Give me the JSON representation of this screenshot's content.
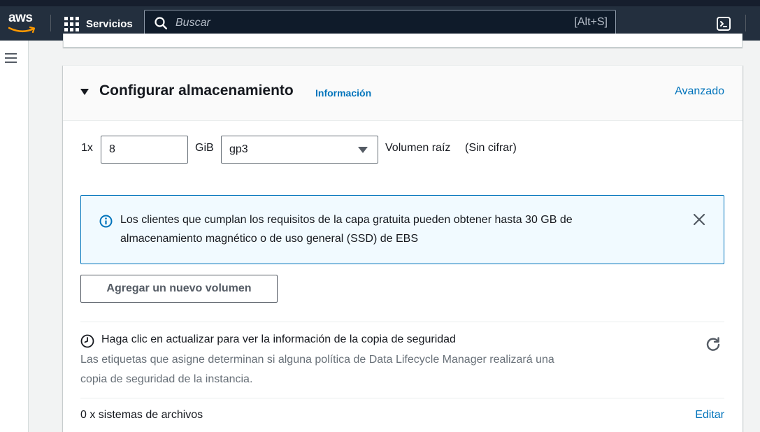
{
  "topbar": {
    "logo_text": "aws",
    "services_label": "Servicios",
    "search_placeholder": "Buscar",
    "search_shortcut": "[Alt+S]",
    "cloudshell_icon": "cloudshell-icon"
  },
  "storage": {
    "title": "Configurar almacenamiento",
    "info_link": "Información",
    "advanced_link": "Avanzado",
    "quantity_label": "1x",
    "size_value": "8",
    "size_unit": "GiB",
    "volume_type": "gp3",
    "volume_label": "Volumen raíz",
    "encryption_label": "(Sin cifrar)",
    "alert": {
      "message": "Los clientes que cumplan los requisitos de la capa gratuita pueden obtener hasta 30 GB de almacenamiento magnético o de uso general (SSD) de EBS"
    },
    "add_volume_button": "Agregar un nuevo volumen",
    "backup": {
      "title": "Haga clic en actualizar para ver la información de la copia de seguridad",
      "description": "Las etiquetas que asigne determinan si alguna política de Data Lifecycle Manager realizará una copia de seguridad de la instancia."
    },
    "file_systems_label": "0 x sistemas de archivos",
    "edit_link": "Editar"
  },
  "colors": {
    "nav_bg": "#232f3e",
    "link": "#0073bb",
    "alert_bg": "#f1faff",
    "aws_orange": "#ff9900"
  }
}
